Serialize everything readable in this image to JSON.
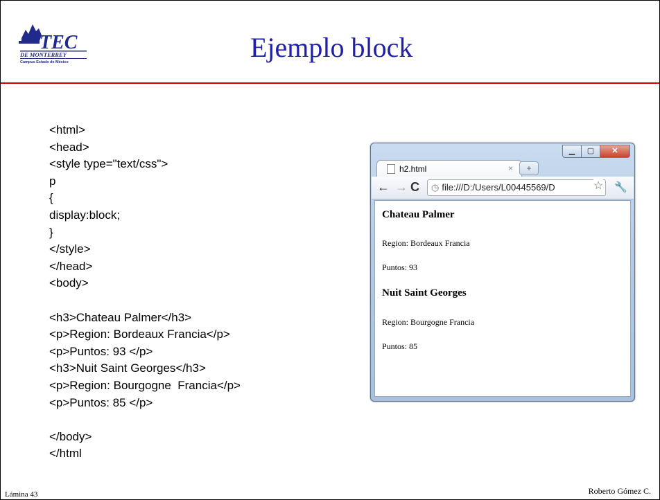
{
  "slide": {
    "title": "Ejemplo block",
    "footer_left": "Lámina 43",
    "footer_right": "Roberto Gómez C.",
    "logo": {
      "text": "TEC DE MONTERREY Campus Estado de México"
    },
    "code_lines": [
      "<html>",
      "<head>",
      "<style type=\"text/css\">",
      "p",
      "{",
      "display:block;",
      "}",
      "</style>",
      "</head>",
      "<body>",
      "",
      "<h3>Chateau Palmer</h3>",
      "<p>Region: Bordeaux Francia</p>",
      "<p>Puntos: 93 </p>",
      "<h3>Nuit Saint Georges</h3>",
      "<p>Region: Bourgogne  Francia</p>",
      "<p>Puntos: 85 </p>",
      "",
      "</body>",
      "</html"
    ]
  },
  "browser": {
    "tab_label": "h2.html",
    "tab_close": "×",
    "url": "file:///D:/Users/L00445569/D",
    "content": {
      "h3_1": "Chateau Palmer",
      "p_1": "Region: Bordeaux Francia",
      "p_2": "Puntos: 93",
      "h3_2": "Nuit Saint Georges",
      "p_3": "Region: Bourgogne Francia",
      "p_4": "Puntos: 85"
    }
  },
  "colors": {
    "title": "#1f1fa8",
    "rule": "#cc0000"
  },
  "icons": [
    "tec-logo",
    "page-icon",
    "new-tab-icon",
    "back-arrow-icon",
    "forward-arrow-icon",
    "reload-icon",
    "globe-icon",
    "star-icon",
    "wrench-icon",
    "minimize-icon",
    "maximize-icon",
    "close-icon"
  ]
}
